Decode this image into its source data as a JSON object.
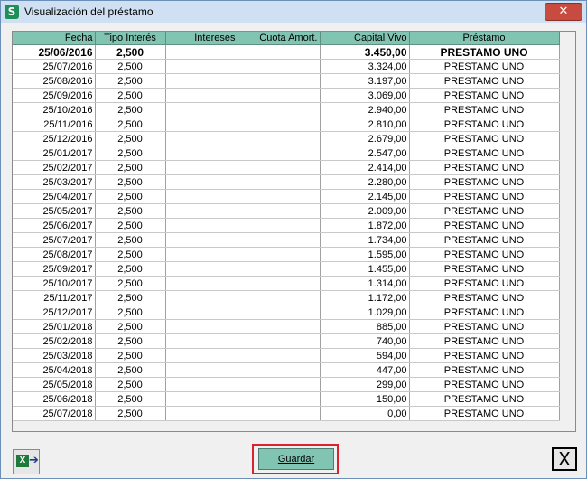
{
  "window": {
    "title": "Visualización del  préstamo",
    "close_icon": "✕"
  },
  "table": {
    "columns": [
      "Fecha",
      "Tipo Interés",
      "Intereses",
      "Cuota Amort.",
      "Capital Vivo",
      "Préstamo"
    ],
    "rows": [
      [
        "25/06/2016",
        "2,500",
        "",
        "",
        "3.450,00",
        "PRESTAMO UNO"
      ],
      [
        "25/07/2016",
        "2,500",
        "",
        "",
        "3.324,00",
        "PRESTAMO UNO"
      ],
      [
        "25/08/2016",
        "2,500",
        "",
        "",
        "3.197,00",
        "PRESTAMO UNO"
      ],
      [
        "25/09/2016",
        "2,500",
        "",
        "",
        "3.069,00",
        "PRESTAMO UNO"
      ],
      [
        "25/10/2016",
        "2,500",
        "",
        "",
        "2.940,00",
        "PRESTAMO UNO"
      ],
      [
        "25/11/2016",
        "2,500",
        "",
        "",
        "2.810,00",
        "PRESTAMO UNO"
      ],
      [
        "25/12/2016",
        "2,500",
        "",
        "",
        "2.679,00",
        "PRESTAMO UNO"
      ],
      [
        "25/01/2017",
        "2,500",
        "",
        "",
        "2.547,00",
        "PRESTAMO UNO"
      ],
      [
        "25/02/2017",
        "2,500",
        "",
        "",
        "2.414,00",
        "PRESTAMO UNO"
      ],
      [
        "25/03/2017",
        "2,500",
        "",
        "",
        "2.280,00",
        "PRESTAMO UNO"
      ],
      [
        "25/04/2017",
        "2,500",
        "",
        "",
        "2.145,00",
        "PRESTAMO UNO"
      ],
      [
        "25/05/2017",
        "2,500",
        "",
        "",
        "2.009,00",
        "PRESTAMO UNO"
      ],
      [
        "25/06/2017",
        "2,500",
        "",
        "",
        "1.872,00",
        "PRESTAMO UNO"
      ],
      [
        "25/07/2017",
        "2,500",
        "",
        "",
        "1.734,00",
        "PRESTAMO UNO"
      ],
      [
        "25/08/2017",
        "2,500",
        "",
        "",
        "1.595,00",
        "PRESTAMO UNO"
      ],
      [
        "25/09/2017",
        "2,500",
        "",
        "",
        "1.455,00",
        "PRESTAMO UNO"
      ],
      [
        "25/10/2017",
        "2,500",
        "",
        "",
        "1.314,00",
        "PRESTAMO UNO"
      ],
      [
        "25/11/2017",
        "2,500",
        "",
        "",
        "1.172,00",
        "PRESTAMO UNO"
      ],
      [
        "25/12/2017",
        "2,500",
        "",
        "",
        "1.029,00",
        "PRESTAMO UNO"
      ],
      [
        "25/01/2018",
        "2,500",
        "",
        "",
        "885,00",
        "PRESTAMO UNO"
      ],
      [
        "25/02/2018",
        "2,500",
        "",
        "",
        "740,00",
        "PRESTAMO UNO"
      ],
      [
        "25/03/2018",
        "2,500",
        "",
        "",
        "594,00",
        "PRESTAMO UNO"
      ],
      [
        "25/04/2018",
        "2,500",
        "",
        "",
        "447,00",
        "PRESTAMO UNO"
      ],
      [
        "25/05/2018",
        "2,500",
        "",
        "",
        "299,00",
        "PRESTAMO UNO"
      ],
      [
        "25/06/2018",
        "2,500",
        "",
        "",
        "150,00",
        "PRESTAMO UNO"
      ],
      [
        "25/07/2018",
        "2,500",
        "",
        "",
        "0,00",
        "PRESTAMO UNO"
      ]
    ]
  },
  "footer": {
    "export_icon": "excel-export-icon",
    "guardar_label": "Guardar",
    "exit_icon": "X"
  },
  "colors": {
    "header_bg": "#82c4b2",
    "highlight_border": "#d9232f"
  }
}
